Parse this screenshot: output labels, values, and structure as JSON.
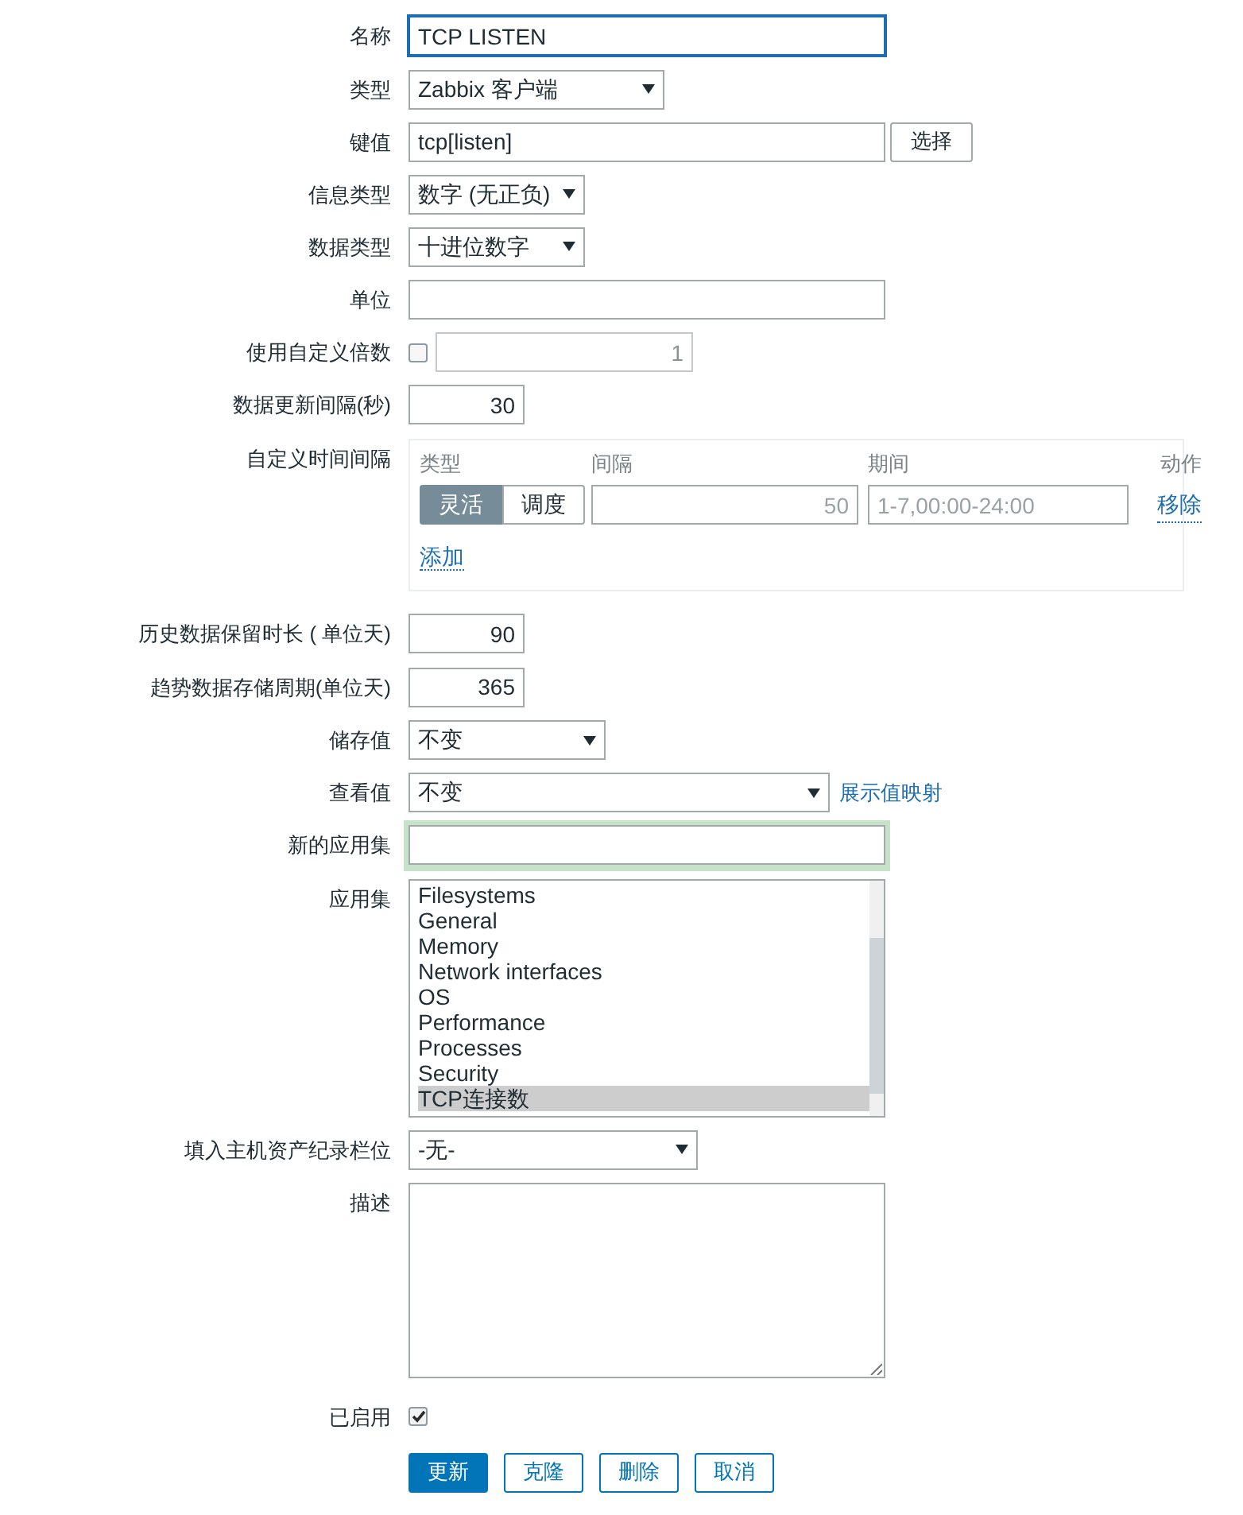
{
  "fields": [
    {
      "kind": "text",
      "label": "名称",
      "value": "TCP LISTEN",
      "focused": true
    },
    {
      "kind": "select",
      "label": "类型",
      "value": "Zabbix 客户端"
    },
    {
      "kind": "text_button",
      "label": "键值",
      "value": "tcp[listen]",
      "button": "选择"
    },
    {
      "kind": "select",
      "label": "信息类型",
      "value": "数字 (无正负)"
    },
    {
      "kind": "select",
      "label": "数据类型",
      "value": "十进位数字"
    },
    {
      "kind": "text",
      "label": "单位",
      "focused": false
    },
    {
      "kind": "checkbox_number",
      "label": "使用自定义倍数",
      "checked": false,
      "value": "1"
    },
    {
      "kind": "number",
      "label": "数据更新间隔(秒)",
      "value": "30"
    },
    {
      "kind": "intervals",
      "label": "自定义时间间隔",
      "headers": [
        "类型",
        "间隔",
        "期间",
        "动作"
      ],
      "rows": [
        {
          "modes": [
            {
              "label": "灵活",
              "selected": true
            },
            {
              "label": "调度",
              "selected": false
            }
          ],
          "interval_placeholder": "50",
          "period_placeholder": "1-7,00:00-24:00",
          "remove": "移除"
        }
      ],
      "add": "添加"
    },
    {
      "kind": "number",
      "label": "历史数据保留时长 ( 单位天)",
      "value": "90"
    },
    {
      "kind": "number",
      "label": "趋势数据存储周期(单位天)",
      "value": "365"
    },
    {
      "kind": "select",
      "label": "储存值",
      "value": "不变"
    },
    {
      "kind": "select_link",
      "label": "查看值",
      "value": "不变",
      "link": "展示值映射"
    },
    {
      "kind": "text",
      "label": "新的应用集",
      "focused": false,
      "highlighted": true
    },
    {
      "kind": "listbox",
      "label": "应用集",
      "options": [
        {
          "label": "Filesystems",
          "selected": false
        },
        {
          "label": "General",
          "selected": false
        },
        {
          "label": "Memory",
          "selected": false
        },
        {
          "label": "Network interfaces",
          "selected": false
        },
        {
          "label": "OS",
          "selected": false
        },
        {
          "label": "Performance",
          "selected": false
        },
        {
          "label": "Processes",
          "selected": false
        },
        {
          "label": "Security",
          "selected": false
        },
        {
          "label": "TCP连接数",
          "selected": true
        }
      ]
    },
    {
      "kind": "select",
      "label": "填入主机资产纪录栏位",
      "value": "-无-"
    },
    {
      "kind": "textarea",
      "label": "描述"
    },
    {
      "kind": "checkbox",
      "label": "已启用",
      "checked": true
    }
  ],
  "buttons": [
    {
      "label": "更新",
      "primary": true
    },
    {
      "label": "克隆",
      "primary": false
    },
    {
      "label": "删除",
      "primary": false
    },
    {
      "label": "取消",
      "primary": false
    }
  ]
}
